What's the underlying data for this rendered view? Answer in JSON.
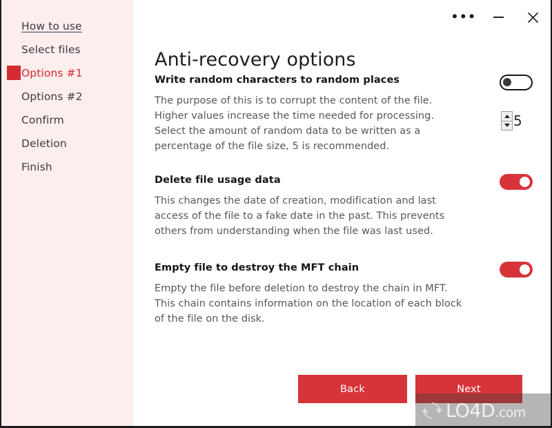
{
  "window": {
    "controls": {
      "more_label": "•••",
      "more_icon": "ellipsis-icon",
      "minimize_label": "—",
      "minimize_icon": "minimize-icon",
      "close_label": "✕",
      "close_icon": "close-icon"
    }
  },
  "sidebar": {
    "items": [
      {
        "label": "How to use",
        "active": false,
        "link": true
      },
      {
        "label": "Select files",
        "active": false,
        "link": false
      },
      {
        "label": "Options #1",
        "active": true,
        "link": false
      },
      {
        "label": "Options #2",
        "active": false,
        "link": false
      },
      {
        "label": "Confirm",
        "active": false,
        "link": false
      },
      {
        "label": "Deletion",
        "active": false,
        "link": false
      },
      {
        "label": "Finish",
        "active": false,
        "link": false
      }
    ]
  },
  "main": {
    "title": "Anti-recovery options",
    "options": [
      {
        "heading": "Write random characters to random places",
        "description": "The purpose of this is to corrupt the content of the file. Higher values increase the time needed for processing. Select the amount of random data to be written as a percentage of the file size, 5 is recommended.",
        "toggle_state": "off"
      },
      {
        "heading": "Delete file usage data",
        "description": "This changes the date of creation, modification and last access of the file to a fake date in the past. This prevents others from understanding when the file was last used.",
        "toggle_state": "on"
      },
      {
        "heading": "Empty file to destroy the MFT chain",
        "description": "Empty the file before deletion to destroy the chain in MFT. This chain contains information on the location of each block of the file on the disk.",
        "toggle_state": "on"
      }
    ],
    "spinner": {
      "value": "5"
    }
  },
  "footer": {
    "back_label": "Back",
    "next_label": "Next"
  },
  "watermark": {
    "text": "LO4D",
    "suffix": ".com",
    "icon": "refresh-arrows-icon"
  },
  "colors": {
    "accent_red": "#d7343a",
    "sidebar_bg": "#fdeeee",
    "active_text": "#d52b33",
    "body_text": "#56565e",
    "heading_text": "#161616"
  }
}
